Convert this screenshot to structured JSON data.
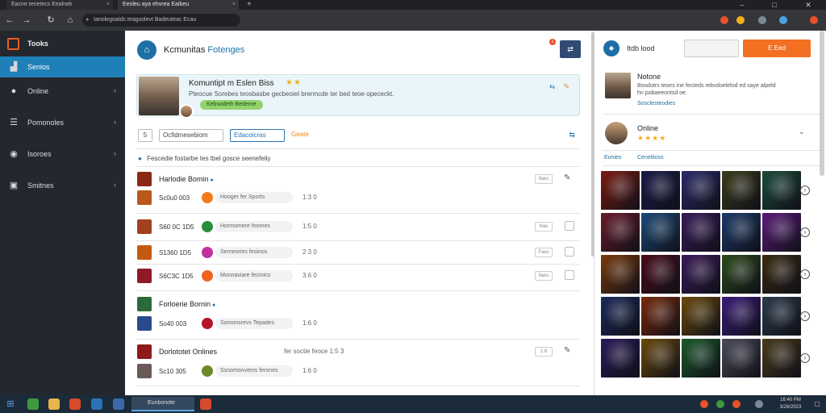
{
  "browser": {
    "tabs": [
      {
        "label": "Eacne tenetecs Eealnek"
      },
      {
        "label": "Eeoleu aya ehvrea Eaibeu"
      }
    ],
    "new_tab_icon": "plus-icon",
    "url": "Ianolegoatdc.teagsolevt Badeuteac Ecau",
    "window_controls": [
      "minimize-icon",
      "maximize-icon",
      "close-icon"
    ],
    "extension_colors": [
      "#e8512a",
      "#f2b01e",
      "#7c8a98",
      "#4aa3df",
      "#e8512a"
    ]
  },
  "sidebar": {
    "brand_label": "Tooks",
    "items": [
      {
        "label": "Senios",
        "icon": "chart-icon",
        "active": true
      },
      {
        "label": "Online",
        "icon": "globe-icon",
        "active": false
      },
      {
        "label": "Pomonoles",
        "icon": "table-icon",
        "active": false
      },
      {
        "label": "Isoroes",
        "icon": "circle-icon",
        "active": false
      },
      {
        "label": "Smitnes",
        "icon": "box-icon",
        "active": false
      }
    ]
  },
  "header": {
    "title": "Kcmunitas",
    "subtitle": "Fotenges",
    "notification_count": "1",
    "button_icon": "swap-icon"
  },
  "profile": {
    "name": "Komuntipt m Eslen Biss",
    "stars": "★★",
    "description": "Pteocue Sorebes teosbasbe gecbeoiel brermcde ter bed teoe opececkt.",
    "tag": "Kebsodeth Bedeme",
    "action_icon": "share-icon",
    "edit_icon": "pencil-icon"
  },
  "filters": {
    "count_box": "5",
    "box1": "Ocfidmesebiom",
    "box2": "Edacoicras",
    "orange_link": "Geate",
    "refresh_icon": "refresh-icon"
  },
  "note": "Fescedie fostarbe tes tbel gosce seenefeliy",
  "groups": [
    {
      "name": "Harlodie Bomin",
      "thumb_color": "#8a2a14",
      "extra": "",
      "badge": "Ilaes",
      "matches": [
        {
          "time": "Sc0u0 003",
          "ball_color": "#f27c1e",
          "chip": "Hooger fer Sports",
          "score": "1:3 0",
          "thumb_color": "#b8581a",
          "has_check": false
        }
      ]
    },
    {
      "name": "",
      "thumb_color": "",
      "extra": "",
      "badge": "",
      "matches": [
        {
          "time": "S60 0C 1D5",
          "ball_color": "#2a8c3a",
          "chip": "Hormomere feomes",
          "score": "1:5 0",
          "thumb_color": "#a1401e",
          "has_check": true,
          "badge": "Nas"
        },
        {
          "time": "S1360 1D5",
          "ball_color": "#c42fa0",
          "chip": "Serneories feoinos",
          "score": "2 3 0",
          "thumb_color": "#c45a12",
          "has_check": true,
          "badge": "Faes"
        },
        {
          "time": "S6C3C 1D5",
          "ball_color": "#f0621e",
          "chip": "Monnaviare fecmics",
          "score": "3.6 0",
          "thumb_color": "#8e1a26",
          "has_check": true,
          "badge": "Ilaes"
        }
      ]
    },
    {
      "name": "Forloerie Bornin",
      "thumb_color": "#2c6a3a",
      "extra": "",
      "badge": "",
      "matches": [
        {
          "time": "So40 003",
          "ball_color": "#b5132a",
          "chip": "Somonsrevs Tepades",
          "score": "1:6 0",
          "thumb_color": "#2a4a8e",
          "has_check": false
        }
      ]
    },
    {
      "name": "Dorlototet Onlines",
      "thumb_color": "#8e1a1a",
      "extra": "fer soctie feoce 1:5 3",
      "badge": "1:8",
      "matches": [
        {
          "time": "Sc10 305",
          "ball_color": "#6a8a2a",
          "chip": "Ssnomonvems ferones",
          "score": "1:6 0",
          "thumb_color": "#6a5a5a",
          "has_check": false
        }
      ]
    }
  ],
  "right_panel": {
    "title": "Itdb lood",
    "secondary_button": "",
    "primary_button": "E Eed",
    "user_name": "Notone",
    "user_desc": "Bosdotrs teoes ine fecteds rebvdoelelod ed saye alpeld hn pobaeeontsd oe.",
    "user_link": "Sosclesteodies",
    "online_label": "Online",
    "online_stars": "★★★★",
    "tabs": [
      "Eonies",
      "Cenelitoss"
    ],
    "tile_colors": [
      [
        "#7a1a10",
        "#1a1a4a",
        "#2a2a6a",
        "#3a3a1a",
        "#1a4a3a"
      ],
      [
        "#6a1a2a",
        "#1a4a7a",
        "#3a1a5a",
        "#1a3a6a",
        "#5a1a7a"
      ],
      [
        "#7a3a0a",
        "#4a0a1a",
        "#3a1a5a",
        "#2a4a1a",
        "#3a2a10"
      ],
      [
        "#1a2a5a",
        "#7a2a0a",
        "#6a4a0a",
        "#3a1a7a",
        "#2a3a4a"
      ],
      [
        "#2a1a5a",
        "#6a4a0a",
        "#1a5a2a",
        "#4a4a5a",
        "#4a3a1a"
      ]
    ]
  },
  "taskbar": {
    "app_label": "Eunbonote",
    "icon_colors": [
      "#3e9a3e",
      "#e8b64a",
      "#d74a2a",
      "#2a73b6",
      "#3a6aa8"
    ],
    "clock_line1": "16:40 PM",
    "clock_line2": "3/26/2023"
  }
}
